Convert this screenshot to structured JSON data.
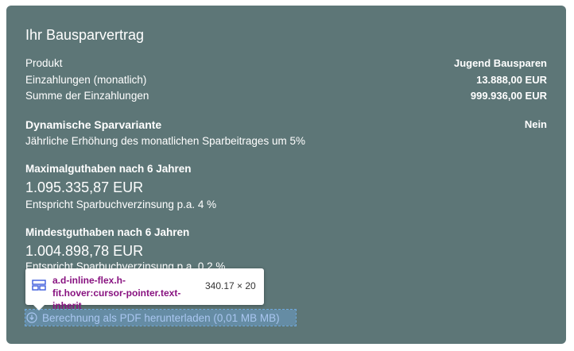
{
  "card": {
    "title": "Ihr Bausparvertrag",
    "rows": [
      {
        "label": "Produkt",
        "value": "Jugend Bausparen"
      },
      {
        "label": "Einzahlungen (monatlich)",
        "value": "13.888,00 EUR"
      },
      {
        "label": "Summe der Einzahlungen",
        "value": "999.936,00 EUR"
      }
    ],
    "dynamic": {
      "label": "Dynamische Sparvariante",
      "value": "Nein",
      "description": "Jährliche Erhöhung des monatlichen Sparbeitrages um 5%"
    },
    "max": {
      "label": "Maximalguthaben nach 6 Jahren",
      "amount": "1.095.335,87 EUR",
      "note": "Entspricht Sparbuchverzinsung p.a. 4 %"
    },
    "min": {
      "label": "Mindestguthaben nach 6 Jahren",
      "amount": "1.004.898,78 EUR",
      "note": "Entspricht Sparbuchverzinsung p.a. 0,2 %"
    },
    "download_link": "Berechnung als PDF herunterladen (0,01 MB MB)"
  },
  "devtools_tooltip": {
    "selector": "a.d-inline-flex.h-fit.hover:cursor-pointer.text-inherit",
    "dimensions": "340.17 × 20",
    "icon": "grid-icon"
  },
  "colors": {
    "card_background": "#5d7677",
    "text": "#ffffff",
    "link_highlight": "#6fa8dc",
    "selector_text": "#881280"
  }
}
